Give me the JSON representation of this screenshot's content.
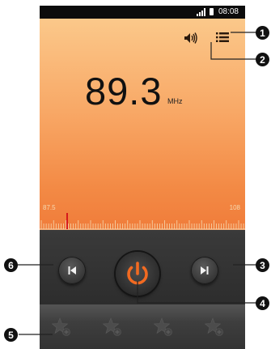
{
  "status": {
    "time": "08:08"
  },
  "radio": {
    "frequency": "89.3",
    "unit": "MHz",
    "scale_min": "87.5",
    "scale_max": "108"
  },
  "icons": {
    "volume": "volume-icon",
    "list": "list-icon",
    "prev": "seek-back-icon",
    "power": "power-icon",
    "next": "seek-forward-icon",
    "favorite": "favorite-star-icon"
  },
  "favorites": {
    "count_visible": 4
  },
  "callouts": [
    "1",
    "2",
    "3",
    "4",
    "5",
    "6"
  ],
  "colors": {
    "accent": "#f07c3a",
    "power_orange": "#f26a21"
  }
}
